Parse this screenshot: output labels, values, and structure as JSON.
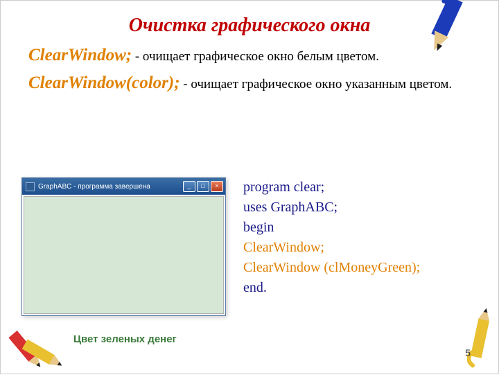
{
  "title": "Очистка графического окна",
  "para1": {
    "cmd": "ClearWindow;",
    "rest": " - очищает графическое окно белым цветом."
  },
  "para2": {
    "cmd": "ClearWindow(color);",
    "rest": " - очищает графическое окно указанным цветом."
  },
  "window": {
    "title": "GraphABC - программа завершена"
  },
  "code": {
    "l1": "program clear;",
    "l2": "uses GraphABC;",
    "l3": "begin",
    "l4": "ClearWindow;",
    "l5": "ClearWindow (clMoneyGreen);",
    "l6": "end."
  },
  "caption": "Цвет зеленых денег",
  "pagenum": "5",
  "winbtn": {
    "min": "_",
    "max": "□",
    "close": "×"
  }
}
